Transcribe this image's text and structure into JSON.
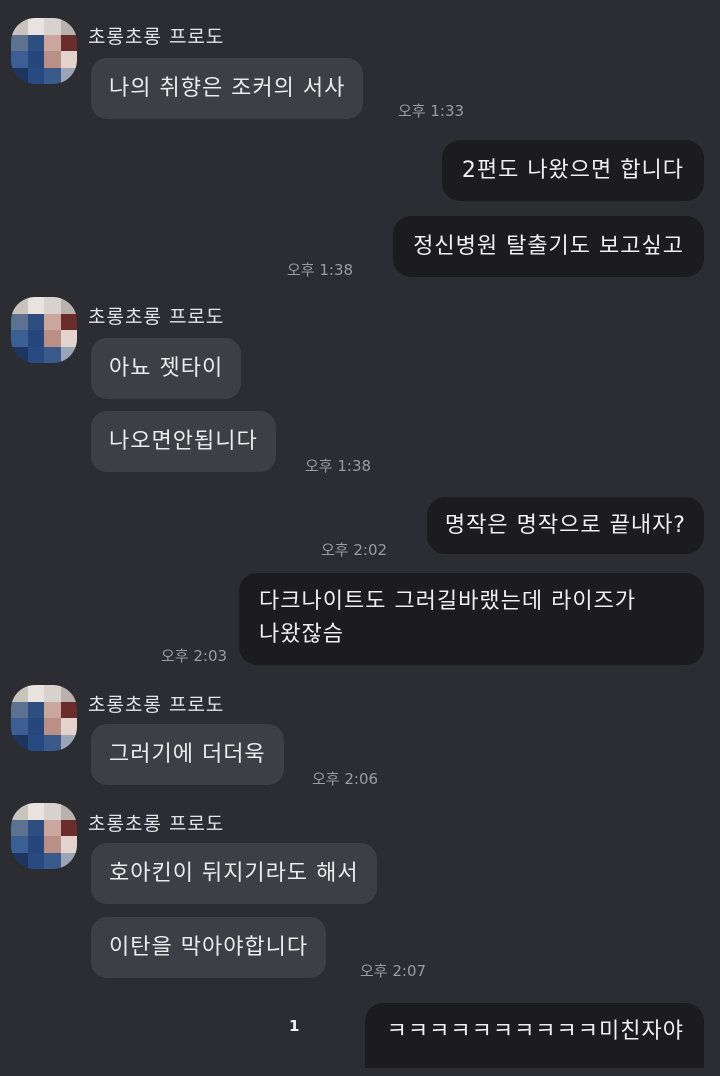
{
  "sender_name": "초롱초롱 프로도",
  "messages": [
    {
      "text": "나의 취향은 조커의 서사",
      "time": "오후 1:33"
    },
    {
      "text": "2편도 나왔으면 합니다"
    },
    {
      "text": "정신병원 탈출기도 보고싶고",
      "time": "오후 1:38"
    },
    {
      "text": "아뇨 젯타이"
    },
    {
      "text": "나오면안됩니다",
      "time": "오후 1:38"
    },
    {
      "text": "명작은 명작으로 끝내자?",
      "time": "오후 2:02"
    },
    {
      "lines": [
        "다크나이트도 그러길바랬는데 라이즈가",
        "나왔잖슴"
      ],
      "time": "오후 2:03"
    },
    {
      "text": "그러기에 더더욱",
      "time": "오후 2:06"
    },
    {
      "text": "호아킨이 뒤지기라도 해서"
    },
    {
      "text": "이탄을 막아야합니다",
      "time": "오후 2:07"
    },
    {
      "text": "ㅋㅋㅋㅋㅋㅋㅋㅋㅋㅋ미친자야",
      "unread": "1"
    }
  ]
}
